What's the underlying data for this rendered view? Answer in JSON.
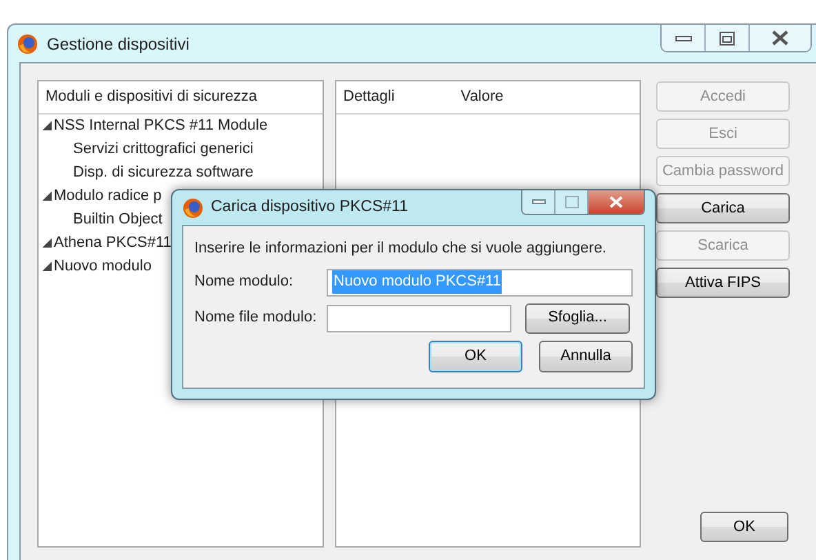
{
  "window": {
    "title": "Gestione dispositivi"
  },
  "tree": {
    "column": "Moduli e dispositivi di sicurezza",
    "items": [
      {
        "label": "NSS Internal PKCS #11 Module",
        "expanded": true,
        "children": [
          {
            "label": "Servizi crittografici generici"
          },
          {
            "label": "Disp. di sicurezza software"
          }
        ]
      },
      {
        "label": "Modulo radice p",
        "expanded": true,
        "children": [
          {
            "label": "Builtin Object"
          }
        ]
      },
      {
        "label": "Athena PKCS#11",
        "expanded": true
      },
      {
        "label": "Nuovo modulo",
        "expanded": true
      }
    ]
  },
  "details": {
    "columns": [
      "Dettagli",
      "Valore"
    ]
  },
  "buttons": [
    {
      "label": "Accedi",
      "disabled": true
    },
    {
      "label": "Esci",
      "disabled": true
    },
    {
      "label": "Cambia password",
      "disabled": true
    },
    {
      "label": "Carica",
      "disabled": false
    },
    {
      "label": "Scarica",
      "disabled": true
    },
    {
      "label": "Attiva FIPS",
      "disabled": false
    }
  ],
  "ok_button": "OK",
  "dialog": {
    "title": "Carica dispositivo PKCS#11",
    "message": "Inserire le informazioni per il modulo che si vuole aggiungere.",
    "fields": [
      {
        "label": "Nome modulo:",
        "value": "Nuovo modulo PKCS#11",
        "selected": true
      },
      {
        "label": "Nome file modulo:",
        "button": "Sfoglia..."
      }
    ],
    "buttons": [
      {
        "label": "OK",
        "default": true
      },
      {
        "label": "Annulla",
        "default": false
      }
    ]
  }
}
